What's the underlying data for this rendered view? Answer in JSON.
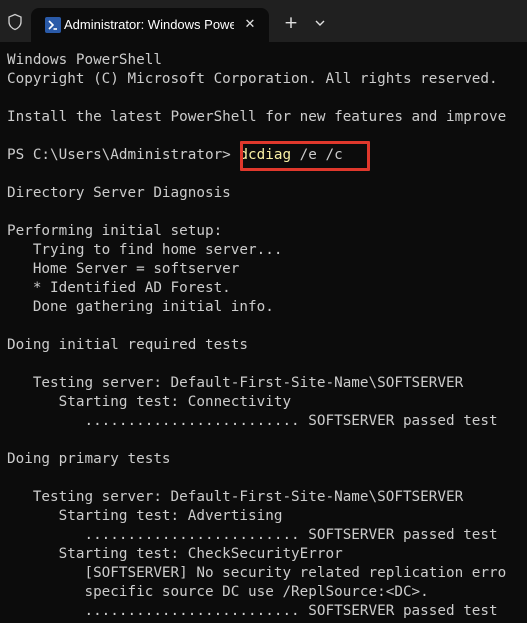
{
  "window": {
    "tab_title": "Administrator: Windows Powe",
    "tab_icon": "powershell-icon",
    "close_glyph": "✕",
    "new_tab_glyph": "+",
    "colors": {
      "titlebar": "#202020",
      "console_bg": "#0c0c0c",
      "console_text": "#cccccc",
      "command_text": "#f9f1a5",
      "highlight_border": "#e0382c"
    }
  },
  "console": {
    "lines": [
      "Windows PowerShell",
      "Copyright (C) Microsoft Corporation. All rights reserved.",
      "",
      "Install the latest PowerShell for new features and improve",
      "",
      "",
      "",
      "Directory Server Diagnosis",
      "",
      "Performing initial setup:",
      "   Trying to find home server...",
      "   Home Server = softserver",
      "   * Identified AD Forest.",
      "   Done gathering initial info.",
      "",
      "Doing initial required tests",
      "",
      "   Testing server: Default-First-Site-Name\\SOFTSERVER",
      "      Starting test: Connectivity",
      "         ......................... SOFTSERVER passed test",
      "",
      "Doing primary tests",
      "",
      "   Testing server: Default-First-Site-Name\\SOFTSERVER",
      "      Starting test: Advertising",
      "         ......................... SOFTSERVER passed test",
      "      Starting test: CheckSecurityError",
      "         [SOFTSERVER] No security related replication erro",
      "         specific source DC use /ReplSource:<DC>.",
      "         ......................... SOFTSERVER passed test"
    ],
    "prompt": "PS C:\\Users\\Administrator>",
    "command": "dcdiag",
    "command_args": "/e /c"
  }
}
